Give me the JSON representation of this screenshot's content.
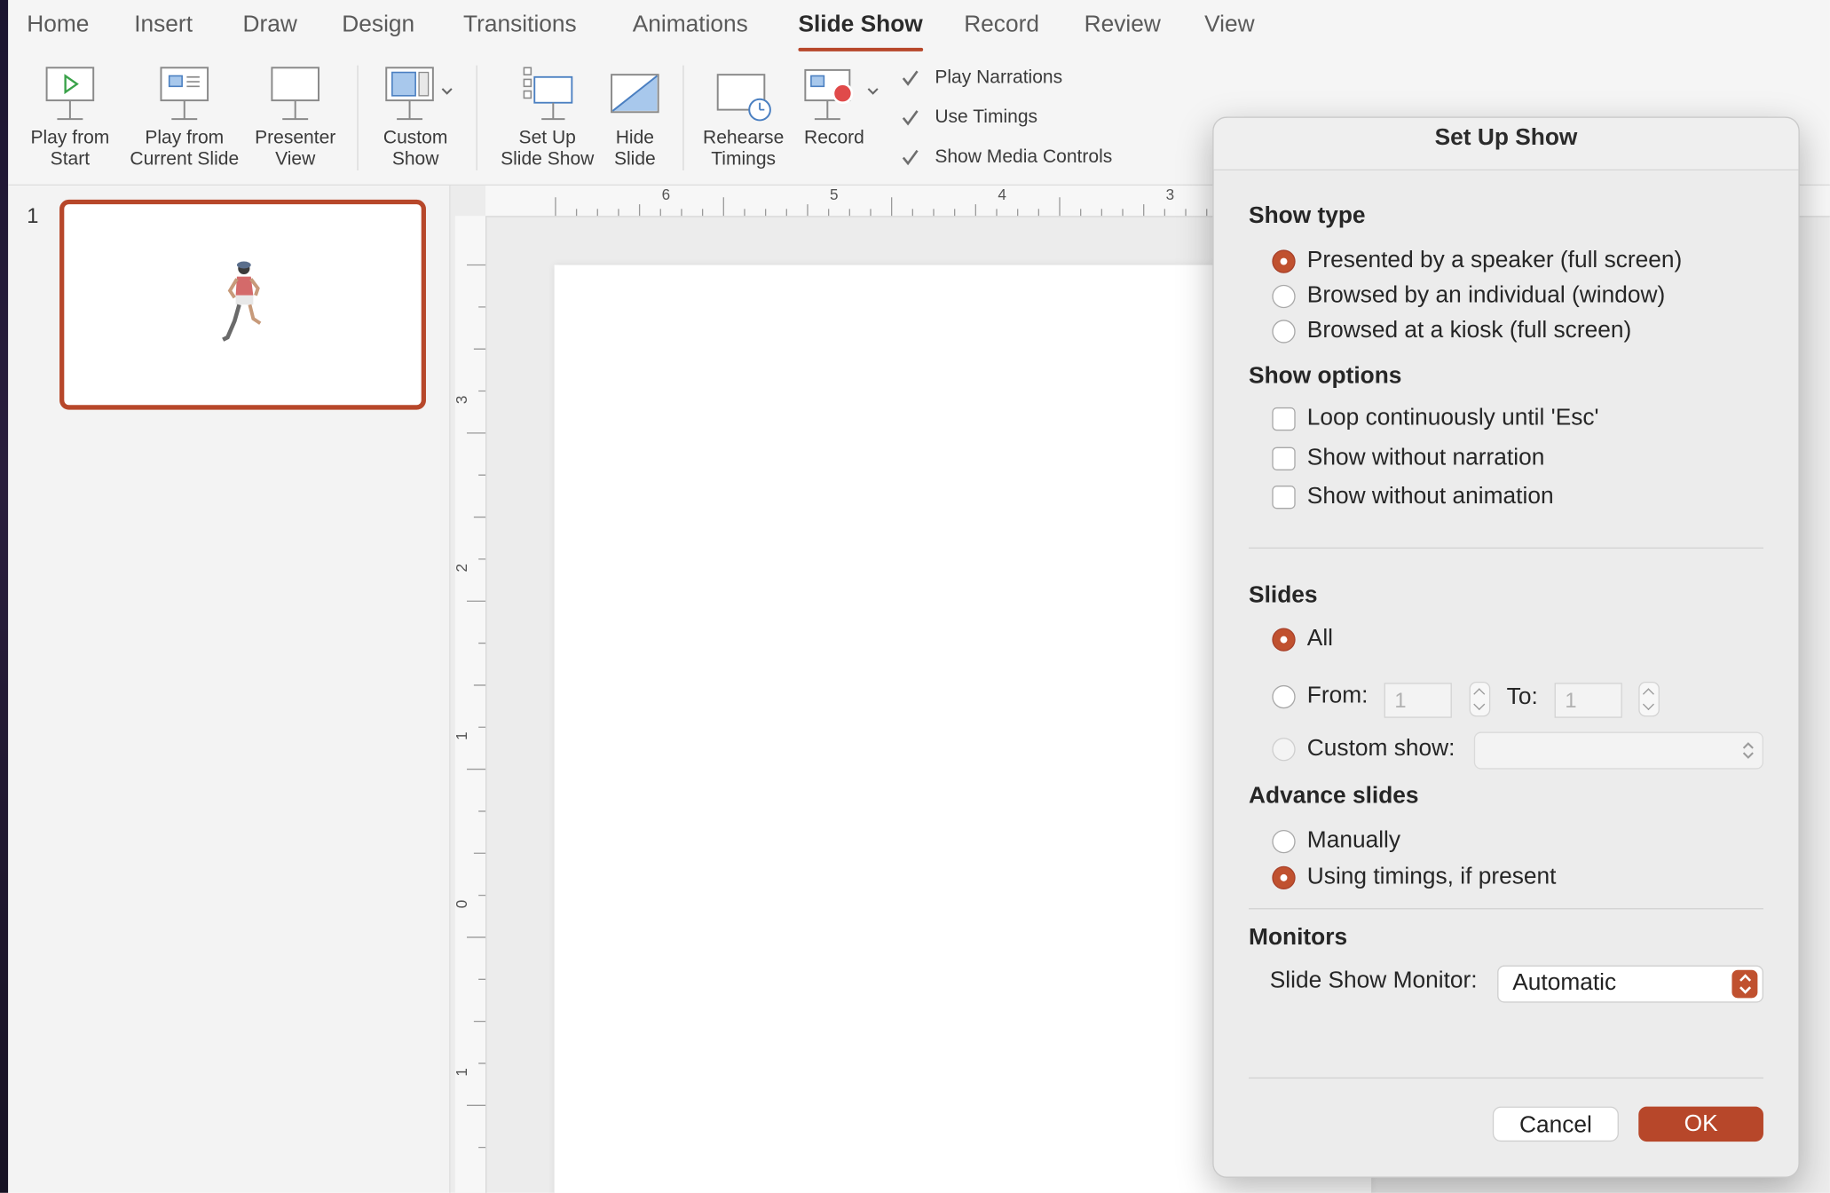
{
  "ribbon": {
    "tabs": [
      "Home",
      "Insert",
      "Draw",
      "Design",
      "Transitions",
      "Animations",
      "Slide Show",
      "Record",
      "Review",
      "View"
    ],
    "active_tab": "Slide Show",
    "buttons": {
      "play_from_start": [
        "Play from",
        "Start"
      ],
      "play_from_current": [
        "Play from",
        "Current Slide"
      ],
      "presenter_view": [
        "Presenter",
        "View"
      ],
      "custom_show": [
        "Custom",
        "Show"
      ],
      "set_up_slide_show": [
        "Set Up",
        "Slide Show"
      ],
      "hide_slide": [
        "Hide",
        "Slide"
      ],
      "rehearse_timings": [
        "Rehearse",
        "Timings"
      ],
      "record": [
        "Record"
      ]
    },
    "checkboxes": [
      {
        "label": "Play Narrations",
        "checked": true
      },
      {
        "label": "Use Timings",
        "checked": true
      },
      {
        "label": "Show Media Controls",
        "checked": true
      }
    ]
  },
  "thumbnails": {
    "slide_number": "1"
  },
  "ruler": {
    "h_labels": [
      "6",
      "5",
      "4",
      "3"
    ],
    "v_labels": [
      "3",
      "2",
      "1",
      "0",
      "1"
    ]
  },
  "dialog": {
    "title": "Set Up Show",
    "show_type": {
      "heading": "Show type",
      "options": [
        {
          "label": "Presented by a speaker (full screen)",
          "selected": true
        },
        {
          "label": "Browsed by an individual (window)",
          "selected": false
        },
        {
          "label": "Browsed at a kiosk (full screen)",
          "selected": false
        }
      ]
    },
    "show_options": {
      "heading": "Show options",
      "options": [
        {
          "label": "Loop continuously until 'Esc'",
          "checked": false
        },
        {
          "label": "Show without narration",
          "checked": false
        },
        {
          "label": "Show without animation",
          "checked": false
        }
      ]
    },
    "slides": {
      "heading": "Slides",
      "all_label": "All",
      "from_label": "From:",
      "from_value": "1",
      "to_label": "To:",
      "to_value": "1",
      "custom_show_label": "Custom show:",
      "custom_show_value": "",
      "selected": "All"
    },
    "advance_slides": {
      "heading": "Advance slides",
      "options": [
        {
          "label": "Manually",
          "selected": false
        },
        {
          "label": "Using timings, if present",
          "selected": true
        }
      ]
    },
    "monitors": {
      "heading": "Monitors",
      "monitor_label": "Slide Show Monitor:",
      "monitor_value": "Automatic"
    },
    "cancel_label": "Cancel",
    "ok_label": "OK"
  },
  "colors": {
    "accent": "#B7472A",
    "dialog_bg": "#ECECEC",
    "ribbon_bg": "#F5F5F5"
  }
}
